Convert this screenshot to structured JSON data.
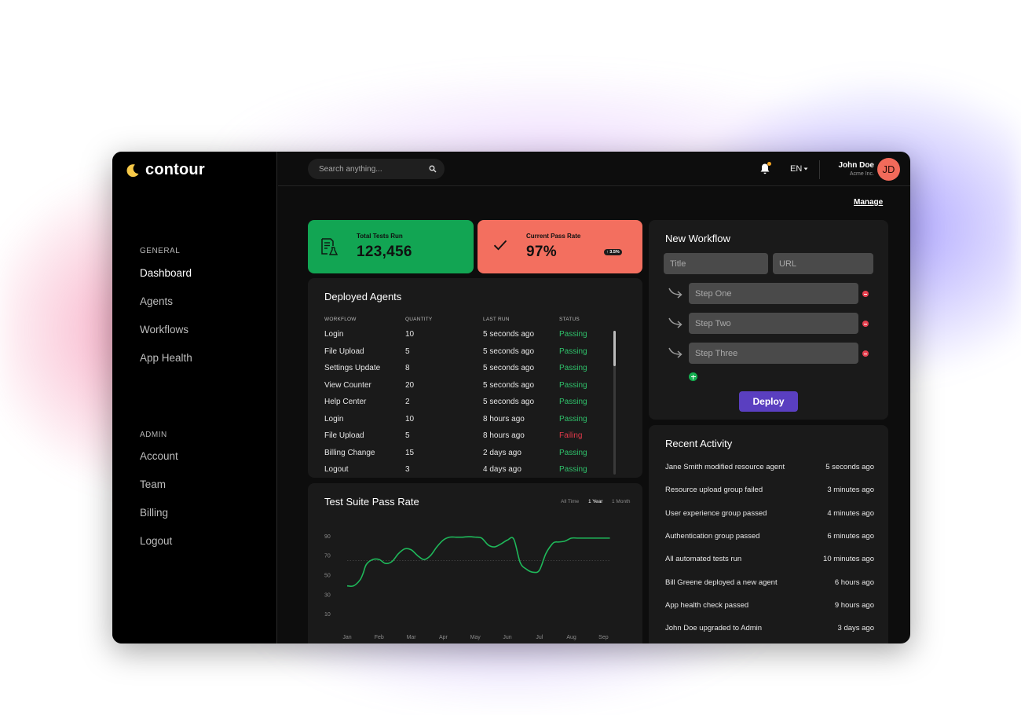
{
  "app": {
    "name": "contour"
  },
  "sidebar": {
    "general_label": "GENERAL",
    "general_items": [
      {
        "label": "Dashboard",
        "active": true
      },
      {
        "label": "Agents"
      },
      {
        "label": "Workflows"
      },
      {
        "label": "App Health"
      }
    ],
    "admin_label": "ADMIN",
    "admin_items": [
      {
        "label": "Account"
      },
      {
        "label": "Team"
      },
      {
        "label": "Billing"
      },
      {
        "label": "Logout"
      }
    ]
  },
  "topbar": {
    "search_placeholder": "Search anything...",
    "language": "EN",
    "user": {
      "name": "John Doe",
      "org": "Acme Inc.",
      "initials": "JD"
    },
    "notification_dot_color": "#f5a623"
  },
  "manage_label": "Manage",
  "stats": {
    "total": {
      "label": "Total Tests Run",
      "value": "123,456",
      "color": "#12a553",
      "icon": "flask-report-icon"
    },
    "pass_rate": {
      "label": "Current Pass Rate",
      "value": "97%",
      "badge": "↑ 3.5%",
      "color": "#f36f5f",
      "icon": "checkmark-icon"
    }
  },
  "deployed_agents": {
    "title": "Deployed Agents",
    "columns": [
      "WORKFLOW",
      "QUANTITY",
      "LAST RUN",
      "STATUS"
    ],
    "rows": [
      {
        "workflow": "Login",
        "quantity": "10",
        "last_run": "5 seconds ago",
        "status": "Passing"
      },
      {
        "workflow": "File Upload",
        "quantity": "5",
        "last_run": "5 seconds ago",
        "status": "Passing"
      },
      {
        "workflow": "Settings Update",
        "quantity": "8",
        "last_run": "5 seconds ago",
        "status": "Passing"
      },
      {
        "workflow": "View Counter",
        "quantity": "20",
        "last_run": "5 seconds ago",
        "status": "Passing"
      },
      {
        "workflow": "Help Center",
        "quantity": "2",
        "last_run": "5 seconds ago",
        "status": "Passing"
      },
      {
        "workflow": "Login",
        "quantity": "10",
        "last_run": "8 hours ago",
        "status": "Passing"
      },
      {
        "workflow": "File Upload",
        "quantity": "5",
        "last_run": "8 hours ago",
        "status": "Failing"
      },
      {
        "workflow": "Billing Change",
        "quantity": "15",
        "last_run": "2 days ago",
        "status": "Passing"
      },
      {
        "workflow": "Logout",
        "quantity": "3",
        "last_run": "4 days ago",
        "status": "Passing"
      }
    ],
    "status_colors": {
      "Passing": "#2fc06a",
      "Failing": "#e0394a"
    }
  },
  "pass_rate_chart": {
    "title": "Test Suite Pass Rate",
    "ranges": [
      {
        "label": "All Time",
        "active": false
      },
      {
        "label": "1 Year",
        "active": true
      },
      {
        "label": "1 Month",
        "active": false
      }
    ]
  },
  "chart_data": {
    "type": "line",
    "title": "Test Suite Pass Rate",
    "x_ticks": [
      "Jan",
      "Feb",
      "Mar",
      "Apr",
      "May",
      "Jun",
      "Jul",
      "Aug",
      "Sep"
    ],
    "y_ticks": [
      90,
      70,
      50,
      30,
      10
    ],
    "ylim": [
      0,
      100
    ],
    "reference_line": 65,
    "line_color": "#1fb85a",
    "series": [
      {
        "x": [
          0,
          0.2,
          0.4,
          0.5,
          0.6,
          0.8,
          1.0,
          1.2,
          1.4,
          1.6,
          1.8,
          2.0,
          2.2,
          2.4,
          2.6,
          2.8,
          3.0,
          3.2,
          3.4,
          3.6,
          3.8,
          4.0,
          4.2,
          4.4,
          4.6,
          4.8,
          5.0,
          5.2,
          5.4,
          5.6,
          5.8,
          6.0,
          6.2,
          6.4,
          6.5,
          6.6,
          6.8,
          7.0,
          7.2,
          7.4,
          7.6,
          7.8,
          8.0,
          8.2
        ],
        "y": [
          39,
          39,
          45,
          52,
          61,
          66,
          66,
          62,
          64,
          72,
          77,
          76,
          70,
          66,
          70,
          79,
          86,
          89,
          89,
          89,
          89.5,
          89,
          88,
          81,
          79,
          82,
          86,
          87,
          63,
          56,
          53,
          55,
          72,
          82,
          84,
          84,
          85,
          88,
          88,
          88,
          88,
          88,
          88,
          88
        ]
      }
    ]
  },
  "new_workflow": {
    "title": "New Workflow",
    "title_placeholder": "Title",
    "url_placeholder": "URL",
    "steps": [
      {
        "placeholder": "Step One"
      },
      {
        "placeholder": "Step Two"
      },
      {
        "placeholder": "Step Three"
      }
    ],
    "deploy_label": "Deploy"
  },
  "recent_activity": {
    "title": "Recent Activity",
    "items": [
      {
        "text": "Jane Smith modified resource agent",
        "time": "5 seconds ago"
      },
      {
        "text": "Resource upload group failed",
        "time": "3 minutes ago"
      },
      {
        "text": "User experience group passed",
        "time": "4 minutes ago"
      },
      {
        "text": "Authentication group passed",
        "time": "6 minutes ago"
      },
      {
        "text": "All automated tests run",
        "time": "10 minutes ago"
      },
      {
        "text": "Bill Greene deployed a new agent",
        "time": "6 hours ago"
      },
      {
        "text": "App health check passed",
        "time": "9 hours ago"
      },
      {
        "text": "John Doe upgraded to Admin",
        "time": "3 days ago"
      }
    ]
  }
}
